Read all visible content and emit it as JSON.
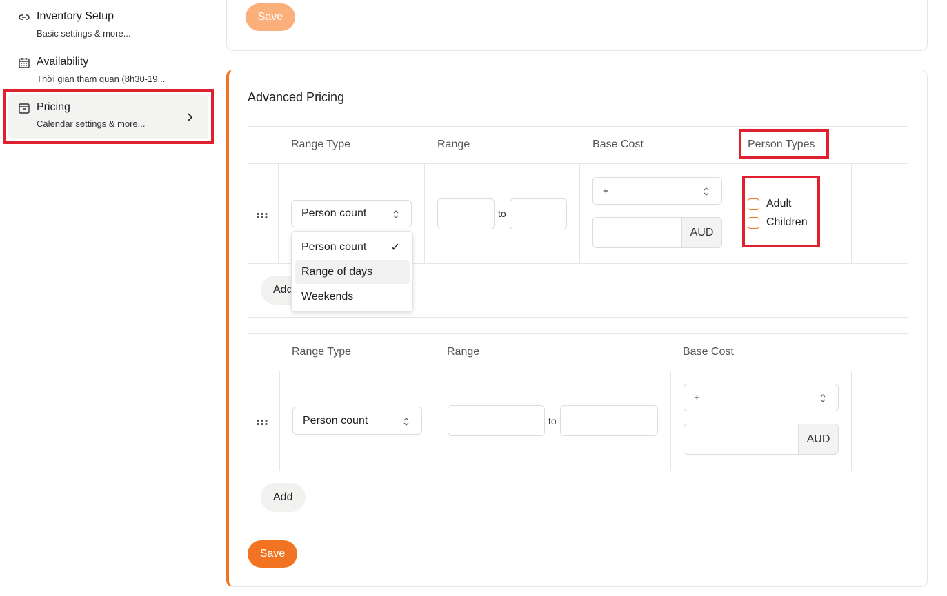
{
  "sidebar": {
    "items": [
      {
        "title": "Inventory Setup",
        "subtitle": "Basic settings & more..."
      },
      {
        "title": "Availability",
        "subtitle": "Thời gian tham quan (8h30-19..."
      },
      {
        "title": "Pricing",
        "subtitle": "Calendar settings & more..."
      }
    ]
  },
  "top_card": {
    "save_label": "Save"
  },
  "advanced": {
    "title": "Advanced Pricing",
    "table1": {
      "headers": {
        "range_type": "Range Type",
        "range": "Range",
        "base_cost": "Base Cost",
        "person_types": "Person Types"
      },
      "row": {
        "range_type_value": "Person count",
        "range_from": "",
        "to_label": "to",
        "range_to": "",
        "operator": "+",
        "cost_value": "",
        "currency": "AUD",
        "person_types": [
          "Adult",
          "Children"
        ]
      },
      "add_label": "Add",
      "dropdown": {
        "options": [
          "Person count",
          "Range of days",
          "Weekends"
        ],
        "selected_mark": "✓"
      }
    },
    "table2": {
      "headers": {
        "range_type": "Range Type",
        "range": "Range",
        "base_cost": "Base Cost"
      },
      "row": {
        "range_type_value": "Person count",
        "range_from": "",
        "to_label": "to",
        "range_to": "",
        "operator": "+",
        "cost_value": "",
        "currency": "AUD"
      },
      "add_label": "Add"
    },
    "save_label": "Save"
  },
  "colors": {
    "accent": "#f27422",
    "accent_faded": "#fbb07c",
    "highlight": "#e0202e"
  }
}
